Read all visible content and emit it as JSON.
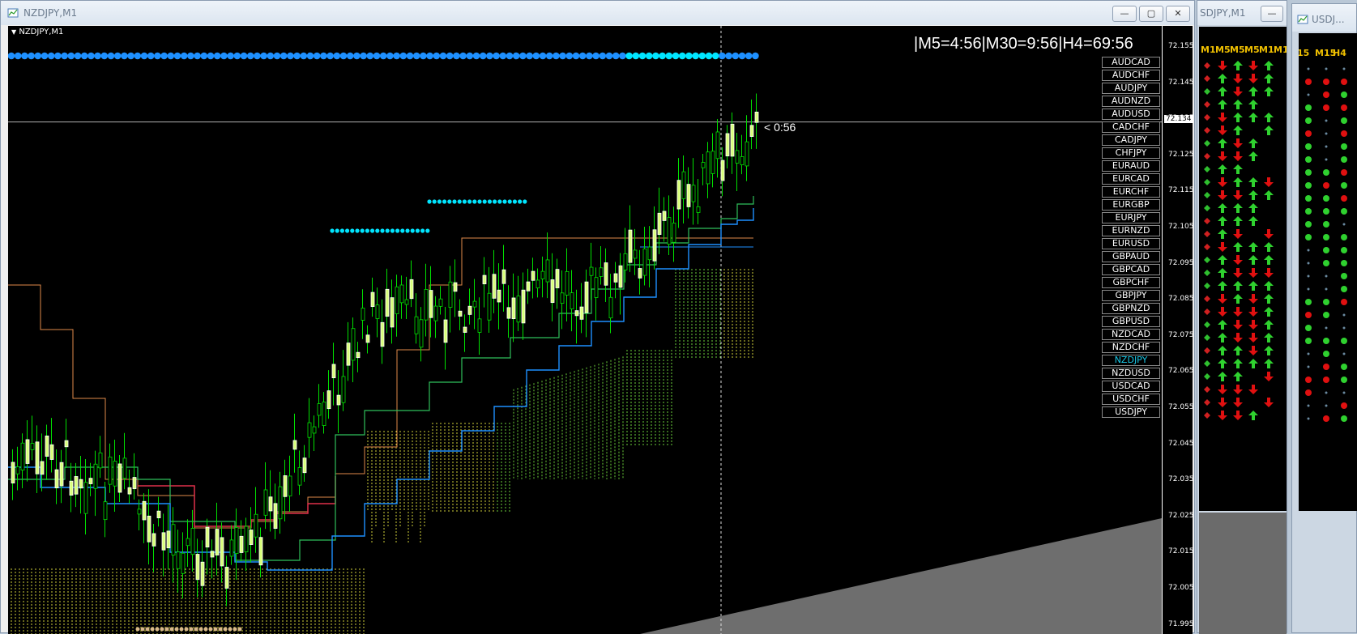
{
  "main_window": {
    "title": "NZDJPY,M1",
    "minimize": "—",
    "maximize": "▢",
    "close": "✕"
  },
  "chart": {
    "symbol_label": "NZDJPY,M1",
    "timer_text": "|M5=4:56|M30=9:56|H4=69:56",
    "countdown": "< 0:56",
    "current_price": "72.134",
    "price_axis": [
      "72.155",
      "72.145",
      "72.135",
      "72.125",
      "72.115",
      "72.105",
      "72.095",
      "72.085",
      "72.075",
      "72.065",
      "72.055",
      "72.045",
      "72.035",
      "72.025",
      "72.015",
      "72.005",
      "71.995"
    ],
    "symbols": [
      "AUDCAD",
      "AUDCHF",
      "AUDJPY",
      "AUDNZD",
      "AUDUSD",
      "CADCHF",
      "CADJPY",
      "CHFJPY",
      "EURAUD",
      "EURCAD",
      "EURCHF",
      "EURGBP",
      "EURJPY",
      "EURNZD",
      "EURUSD",
      "GBPAUD",
      "GBPCAD",
      "GBPCHF",
      "GBPJPY",
      "GBPNZD",
      "GBPUSD",
      "NZDCAD",
      "NZDCHF",
      "NZDJPY",
      "NZDUSD",
      "USDCAD",
      "USDCHF",
      "USDJPY"
    ],
    "active_symbol": "NZDJPY",
    "colors": {
      "bull": "#00e000",
      "bear": "#d8ff7a",
      "dots": "#1e90ff",
      "dots2": "#00e5ff",
      "line_blue": "#1e90ff",
      "line_green": "#2fbf5b",
      "line_orange": "#e08a4a",
      "line_red": "#e0304a"
    }
  },
  "side_window_1": {
    "title": "SDJPY,M1",
    "headers": [
      "M1",
      "M5",
      "M5",
      "M5",
      "M1",
      "M1"
    ]
  },
  "side_window_2": {
    "title": "USDJ...",
    "headers": [
      "15",
      "M15",
      "H4"
    ]
  }
}
